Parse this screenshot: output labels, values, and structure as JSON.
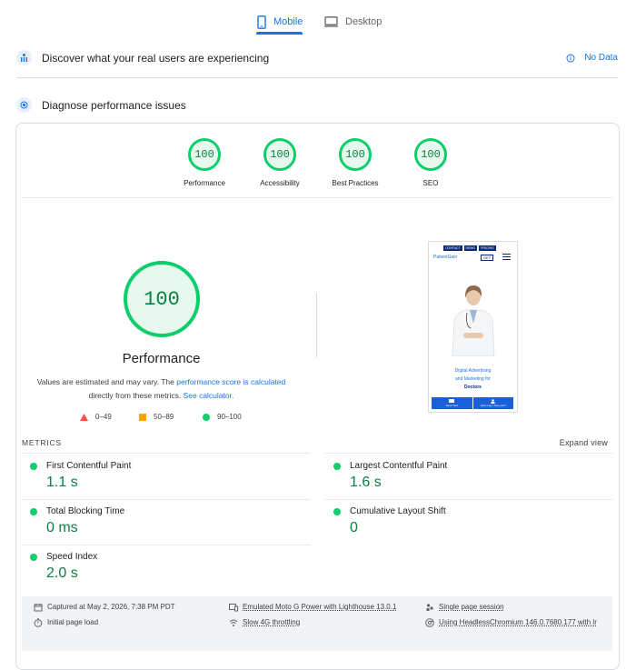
{
  "tabs": [
    {
      "label": "Mobile",
      "icon": "smartphone-icon",
      "active": true
    },
    {
      "label": "Desktop",
      "icon": "desktop-icon",
      "active": false
    }
  ],
  "field_data": {
    "title": "Discover what your real users are experiencing",
    "status": "No Data"
  },
  "diagnose": {
    "title": "Diagnose performance issues"
  },
  "categories": [
    {
      "label": "Performance",
      "score": "100"
    },
    {
      "label": "Accessibility",
      "score": "100"
    },
    {
      "label": "Best Practices",
      "score": "100"
    },
    {
      "label": "SEO",
      "score": "100"
    }
  ],
  "performance": {
    "score": "100",
    "title": "Performance",
    "note_prefix": "Values are estimated and may vary. The ",
    "note_link1": "performance score is calculated",
    "note_mid": " directly from these metrics. ",
    "note_link2": "See calculator."
  },
  "legend": [
    {
      "range": "0–49",
      "color": "#ff4e42"
    },
    {
      "range": "50–89",
      "color": "#ffa400"
    },
    {
      "range": "90–100",
      "color": "#0cce6b"
    }
  ],
  "thumbnail": {
    "nav": [
      "CONTACT",
      "DEMO",
      "PRICING"
    ],
    "logo": "PatientGain",
    "get": "GET",
    "caption1": "Digital Advertising",
    "caption2": "and Marketing for",
    "caption3": "Doctors",
    "bar1": "Send Text",
    "bar2": "How may I help you?"
  },
  "metrics_header": {
    "label": "METRICS",
    "expand": "Expand view"
  },
  "metrics": [
    {
      "name": "First Contentful Paint",
      "value": "1.1 s"
    },
    {
      "name": "Largest Contentful Paint",
      "value": "1.6 s"
    },
    {
      "name": "Total Blocking Time",
      "value": "0 ms"
    },
    {
      "name": "Cumulative Layout Shift",
      "value": "0"
    },
    {
      "name": "Speed Index",
      "value": "2.0 s"
    }
  ],
  "run_info": {
    "captured": "Captured at May 2, 2026, 7:38 PM PDT",
    "load": "Initial page load",
    "device": "Emulated Moto G Power with Lighthouse 13.0.1",
    "throttling": "Slow 4G throttling",
    "session": "Single page session",
    "browser": "Using HeadlessChromium 146.0.7680.177 with lr"
  }
}
